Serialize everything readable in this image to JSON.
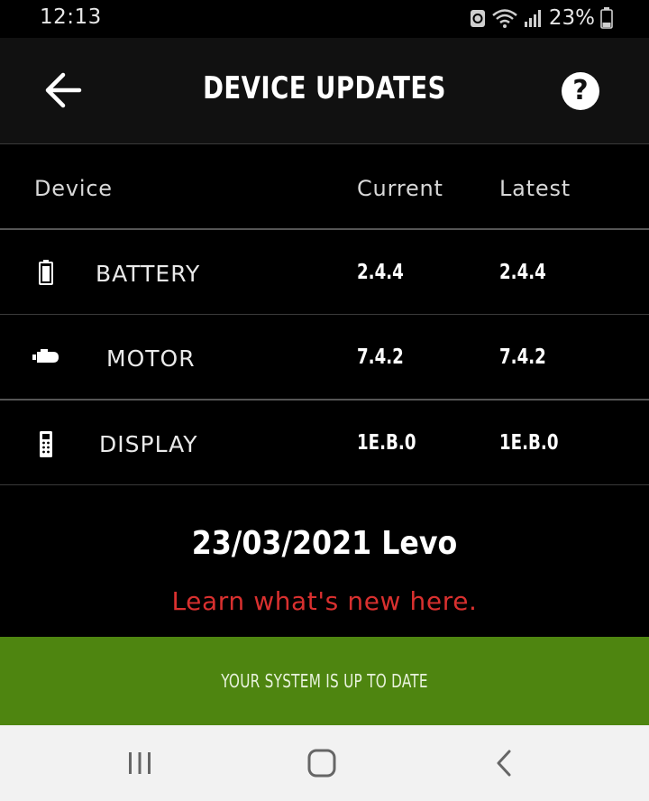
{
  "status_bar": {
    "time": "12:13",
    "battery_percent": "23%"
  },
  "app_bar": {
    "title": "DEVICE UPDATES",
    "help_label": "?"
  },
  "table": {
    "headers": {
      "device": "Device",
      "current": "Current",
      "latest": "Latest"
    },
    "rows": [
      {
        "device": "BATTERY",
        "icon": "battery-icon",
        "current": "2.4.4",
        "latest": "2.4.4"
      },
      {
        "device": "MOTOR",
        "icon": "motor-icon",
        "current": "7.4.2",
        "latest": "7.4.2"
      },
      {
        "device": "DISPLAY",
        "icon": "display-icon",
        "current": "1E.B.0",
        "latest": "1E.B.0"
      }
    ]
  },
  "release": {
    "title": "23/03/2021 Levo",
    "link_text": "Learn what's new here."
  },
  "banner": {
    "text": "YOUR SYSTEM IS UP TO DATE"
  },
  "colors": {
    "accent_red": "#d9302f",
    "banner_green": "#4e8510",
    "app_bar_bg": "#111111"
  }
}
